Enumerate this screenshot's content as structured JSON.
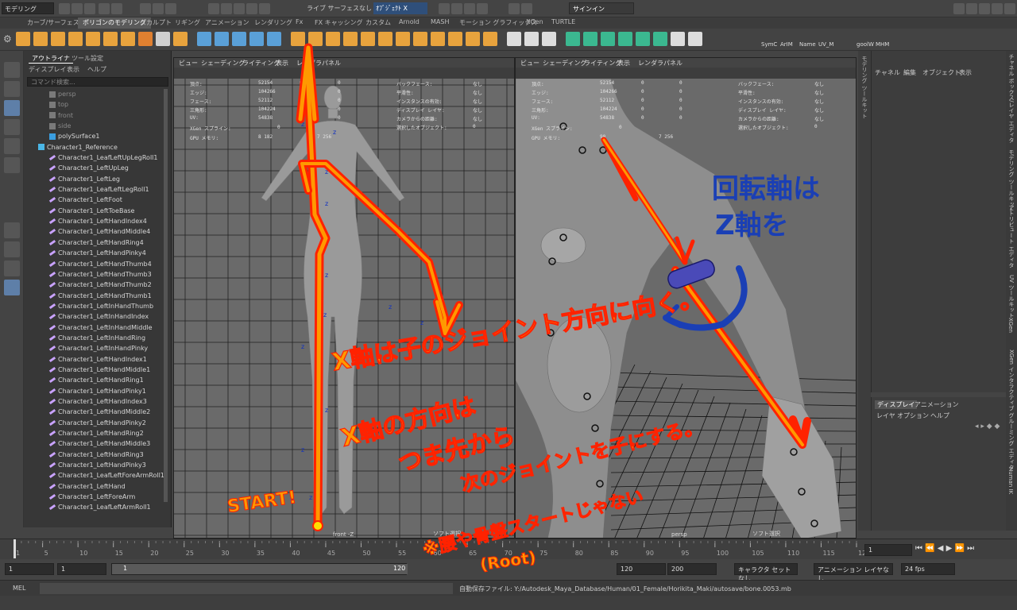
{
  "topbar": {
    "mode": "モデリング",
    "ctx_label": "ライブ サーフェスなし",
    "object_field": "ｵﾌﾞｼﾞｪｸﾄ X",
    "signin": "サインイン"
  },
  "shelf_tabs": [
    "カーブ/サーフェス",
    "ポリゴンのモデリング",
    "スカルプト",
    "リギング",
    "アニメーション",
    "レンダリング",
    "Fx",
    "FX キャッシング",
    "カスタム",
    "Arnold",
    "MASH",
    "モーション グラフィックス",
    "XGen",
    "TURTLE"
  ],
  "shelf_active_index": 1,
  "shelf_right_labels": [
    "SymC",
    "ArIM",
    "Name",
    "UV_M",
    "goolW",
    "MHM"
  ],
  "outliner": {
    "tabs": [
      "アウトライナ",
      "ツール設定"
    ],
    "menu": [
      "ディスプレイ",
      "表示",
      "ヘルプ"
    ],
    "search_placeholder": "コマンド検索...",
    "items": [
      {
        "label": "persp",
        "type": "camera",
        "dim": true
      },
      {
        "label": "top",
        "type": "camera",
        "dim": true
      },
      {
        "label": "front",
        "type": "camera",
        "dim": true
      },
      {
        "label": "side",
        "type": "camera",
        "dim": true
      },
      {
        "label": "polySurface1",
        "type": "mesh",
        "dim": false
      },
      {
        "label": "Character1_Reference",
        "type": "ref",
        "dim": false
      },
      {
        "label": "Character1_LeafLeftUpLegRoll1",
        "type": "joint",
        "dim": false
      },
      {
        "label": "Character1_LeftUpLeg",
        "type": "joint",
        "dim": false
      },
      {
        "label": "Character1_LeftLeg",
        "type": "joint",
        "dim": false
      },
      {
        "label": "Character1_LeafLeftLegRoll1",
        "type": "joint",
        "dim": false
      },
      {
        "label": "Character1_LeftFoot",
        "type": "joint",
        "dim": false
      },
      {
        "label": "Character1_LeftToeBase",
        "type": "joint",
        "dim": false
      },
      {
        "label": "Character1_LeftHandIndex4",
        "type": "joint",
        "dim": false
      },
      {
        "label": "Character1_LeftHandMiddle4",
        "type": "joint",
        "dim": false
      },
      {
        "label": "Character1_LeftHandRing4",
        "type": "joint",
        "dim": false
      },
      {
        "label": "Character1_LeftHandPinky4",
        "type": "joint",
        "dim": false
      },
      {
        "label": "Character1_LeftHandThumb4",
        "type": "joint",
        "dim": false
      },
      {
        "label": "Character1_LeftHandThumb3",
        "type": "joint",
        "dim": false
      },
      {
        "label": "Character1_LeftHandThumb2",
        "type": "joint",
        "dim": false
      },
      {
        "label": "Character1_LeftHandThumb1",
        "type": "joint",
        "dim": false
      },
      {
        "label": "Character1_LeftInHandThumb",
        "type": "joint",
        "dim": false
      },
      {
        "label": "Character1_LeftInHandIndex",
        "type": "joint",
        "dim": false
      },
      {
        "label": "Character1_LeftInHandMiddle",
        "type": "joint",
        "dim": false
      },
      {
        "label": "Character1_LeftInHandRing",
        "type": "joint",
        "dim": false
      },
      {
        "label": "Character1_LeftInHandPinky",
        "type": "joint",
        "dim": false
      },
      {
        "label": "Character1_LeftHandIndex1",
        "type": "joint",
        "dim": false
      },
      {
        "label": "Character1_LeftHandMiddle1",
        "type": "joint",
        "dim": false
      },
      {
        "label": "Character1_LeftHandRing1",
        "type": "joint",
        "dim": false
      },
      {
        "label": "Character1_LeftHandPinky1",
        "type": "joint",
        "dim": false
      },
      {
        "label": "Character1_LeftHandIndex3",
        "type": "joint",
        "dim": false
      },
      {
        "label": "Character1_LeftHandMiddle2",
        "type": "joint",
        "dim": false
      },
      {
        "label": "Character1_LeftHandPinky2",
        "type": "joint",
        "dim": false
      },
      {
        "label": "Character1_LeftHandRing2",
        "type": "joint",
        "dim": false
      },
      {
        "label": "Character1_LeftHandMiddle3",
        "type": "joint",
        "dim": false
      },
      {
        "label": "Character1_LeftHandRing3",
        "type": "joint",
        "dim": false
      },
      {
        "label": "Character1_LeftHandPinky3",
        "type": "joint",
        "dim": false
      },
      {
        "label": "Character1_LeafLeftForeArmRoll1",
        "type": "joint",
        "dim": false
      },
      {
        "label": "Character1_LeftHand",
        "type": "joint",
        "dim": false
      },
      {
        "label": "Character1_LeftForeArm",
        "type": "joint",
        "dim": false
      },
      {
        "label": "Character1_LeafLeftArmRoll1",
        "type": "joint",
        "dim": false
      }
    ]
  },
  "viewport_left": {
    "menu": [
      "ビュー",
      "シェーディング",
      "ライティング",
      "表示",
      "レンダラ",
      "パネル"
    ],
    "hud_rows": [
      {
        "k": "頂点:",
        "a": "52154",
        "b": "0",
        "c": "0"
      },
      {
        "k": "エッジ:",
        "a": "104266",
        "b": "0",
        "c": "0"
      },
      {
        "k": "フェース:",
        "a": "52112",
        "b": "0",
        "c": "0"
      },
      {
        "k": "三角形:",
        "a": "104224",
        "b": "0",
        "c": "0"
      },
      {
        "k": "UV:",
        "a": "54838",
        "b": "0",
        "c": "0"
      }
    ],
    "hud_right": [
      {
        "k": "バックフェース:",
        "v": "なし"
      },
      {
        "k": "平滑性:",
        "v": "なし"
      },
      {
        "k": "インスタンスの有効:",
        "v": "なし"
      },
      {
        "k": "ディスプレイ レイヤ:",
        "v": "なし"
      },
      {
        "k": "カメラからの距離:",
        "v": "なし"
      },
      {
        "k": "選択したオブジェクト:",
        "v": "0"
      }
    ],
    "xgen_label": "XGen スプライン:",
    "xgen_value": "0",
    "gpu_label": "GPU メモリ:",
    "gpu_a": "8 182",
    "gpu_b": "7 256",
    "foot_center": "front -Z",
    "foot_right": "ソフト選択"
  },
  "viewport_right": {
    "menu": [
      "ビュー",
      "シェーディング",
      "ライティング",
      "表示",
      "レンダラ",
      "パネル"
    ],
    "hud_rows": [
      {
        "k": "頂点:",
        "a": "52154",
        "b": "0",
        "c": "0"
      },
      {
        "k": "エッジ:",
        "a": "104266",
        "b": "0",
        "c": "0"
      },
      {
        "k": "フェース:",
        "a": "52112",
        "b": "0",
        "c": "0"
      },
      {
        "k": "三角形:",
        "a": "104224",
        "b": "0",
        "c": "0"
      },
      {
        "k": "UV:",
        "a": "54838",
        "b": "0",
        "c": "0"
      }
    ],
    "hud_right": [
      {
        "k": "バックフェース:",
        "v": "なし"
      },
      {
        "k": "平滑性:",
        "v": "なし"
      },
      {
        "k": "インスタンスの有効:",
        "v": "なし"
      },
      {
        "k": "ディスプレイ レイヤ:",
        "v": "なし"
      },
      {
        "k": "カメラからの距離:",
        "v": "なし"
      },
      {
        "k": "選択したオブジェクト:",
        "v": "0"
      }
    ],
    "xgen_label": "XGen スプライン:",
    "xgen_value": "0",
    "gpu_label": "GPU メモリ:",
    "gpu_a": "90",
    "gpu_b": "7 256",
    "foot_center": "persp",
    "foot_right": "ソフト選択"
  },
  "right_strip_label": "モデリング ツールキット",
  "channel": {
    "menu": [
      "チャネル",
      "編集",
      "オブジェクト",
      "表示"
    ]
  },
  "display_layer": {
    "tabs": [
      "ディスプレイ",
      "アニメーション"
    ],
    "menu": [
      "レイヤ",
      "オプション",
      "ヘルプ"
    ]
  },
  "vertical_tabs": [
    "チャネル ボックス/レイヤ エディタ",
    "モデリング ツールキット",
    "アトリビュート エディタ",
    "UV ツールキット",
    "XGen",
    "XGen インタラクティブ グルーミング エディタ",
    "Human IK"
  ],
  "timeline": {
    "ticks": [
      "1",
      "5",
      "10",
      "15",
      "20",
      "25",
      "30",
      "35",
      "40",
      "45",
      "50",
      "55",
      "60",
      "65",
      "70",
      "75",
      "80",
      "85",
      "90",
      "95",
      "100",
      "105",
      "110",
      "115",
      "120"
    ],
    "current_frame": "1",
    "range_start": "1",
    "range_start2": "1",
    "range_inner_start": "1",
    "range_inner_end": "120",
    "range_end": "120",
    "range_end2": "200",
    "character_set": "キャラクタ セットなし",
    "anim_layer": "アニメーション レイヤなし",
    "fps": "24 fps"
  },
  "cmdline": {
    "label": "MEL",
    "status": "自動保存ファイル: Y:/Autodesk_Maya_Database/Human/01_Female/Horikita_Maki/autosave/bone.0053.mb"
  },
  "annotations": {
    "start": "START!",
    "x_axis_child": "X軸は子のジョイント方向に向く。",
    "rotation_axis_1": "回転軸は",
    "rotation_axis_2": "Z軸を",
    "x_dir_1": "X軸の方向は",
    "x_dir_2": "つま先から",
    "x_dir_3": "次のジョイントを子にする。",
    "note_1": "※腰や骨盤スタートじゃない",
    "note_2": "(Root)",
    "annot_color": "#ff8800",
    "annot_outline": "#ff2200",
    "blue_color": "#1a3fb5"
  }
}
